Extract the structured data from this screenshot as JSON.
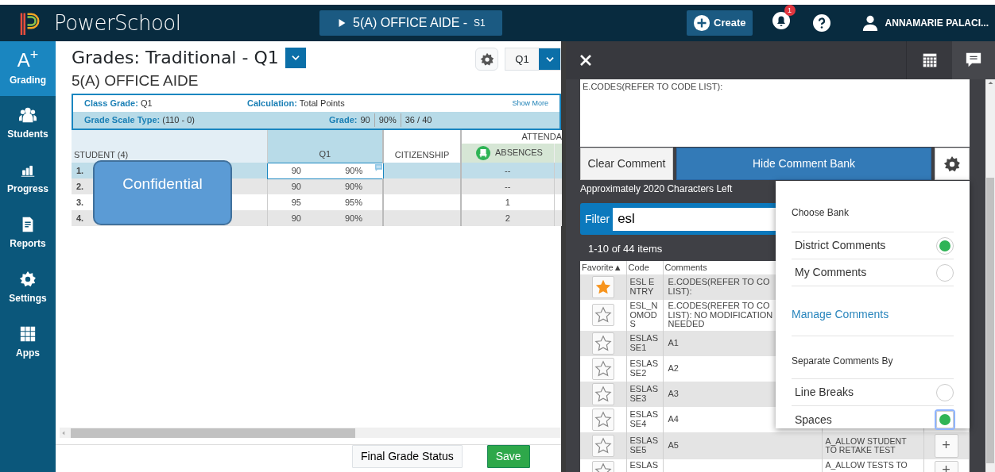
{
  "top_bar": {
    "app_name": "PowerSchool",
    "section": {
      "label": "5(A) OFFICE AIDE -",
      "term": "S1"
    },
    "create": "Create",
    "notification_count": "1",
    "user_name": "ANNAMARIE PALACI..."
  },
  "sidebar": {
    "items": [
      {
        "kind": "grading",
        "icon_text": "A$^{+}$",
        "label": "Grading",
        "selected": true
      },
      {
        "kind": "students",
        "label": "Students",
        "selected": false
      },
      {
        "kind": "progress",
        "label": "Progress",
        "selected": false
      },
      {
        "kind": "reports",
        "label": "Reports",
        "selected": false
      },
      {
        "kind": "settings",
        "label": "Settings",
        "selected": false
      },
      {
        "kind": "apps",
        "label": "Apps",
        "selected": false
      }
    ]
  },
  "main": {
    "title": "Grades: Traditional - Q1",
    "subtitle": "5(A) OFFICE AIDE",
    "term_select": "Q1",
    "summary": {
      "class_grade": "**Class Grade:** Q1",
      "calculation": "**Calculation:** Total Points",
      "show_more": "Show More",
      "grade_scale_type": "**Grade Scale Type:** (110 - 0)",
      "grade_label": "Grade:",
      "grade_parts": [
        "90",
        "90%",
        "36 / 40"
      ]
    },
    "grid": {
      "columns": {
        "student": "STUDENT (4)",
        "q1": "Q1",
        "citizenship": "CITIZENSHIP",
        "group": "ATTENDA",
        "absences": "ABSENCES"
      },
      "rows": [
        {
          "number": "1.",
          "score": "90",
          "percent": "90%",
          "absences": "--",
          "selected": true,
          "has_comment": true
        },
        {
          "number": "2.",
          "score": "90",
          "percent": "90%",
          "absences": "--",
          "selected": false,
          "has_comment": false
        },
        {
          "number": "3.",
          "score": "95",
          "percent": "95%",
          "absences": "1",
          "selected": false,
          "has_comment": false
        },
        {
          "number": "4.",
          "score": "90",
          "percent": "90%",
          "absences": "2",
          "selected": false,
          "has_comment": false
        }
      ]
    },
    "callout": "Confidential",
    "footer_buttons": [
      {
        "kind": "secondary",
        "label": "Final Grade Status"
      },
      {
        "kind": "success",
        "label": "Save"
      }
    ]
  },
  "comment_panel": {
    "comment_text": "E.CODES(REFER TO CODE LIST):",
    "clear_button": "Clear Comment",
    "bank_button": "Hide Comment Bank",
    "chars_left": "Approximately 2020 Characters Left",
    "filter": {
      "label": "Filter",
      "value": "esl"
    },
    "count": "1-10 of 44 items",
    "table": {
      "columns": [
        "Favorite▲",
        "Code",
        "Comments"
      ],
      "rows": [
        {
          "favorite": true,
          "code": "ESL ENTRY",
          "comment": "E.CODES(REFER TO CO\nLIST):"
        },
        {
          "favorite": false,
          "code": "ESL_NOMODS",
          "comment": "E.CODES(REFER TO CO\nLIST): NO MODIFICATION\nNEEDED"
        },
        {
          "favorite": false,
          "code": "ESLASSE1",
          "comment": "A1"
        },
        {
          "favorite": false,
          "code": "ESLASSE2",
          "comment": "A2"
        },
        {
          "favorite": false,
          "code": "ESLASSE3",
          "comment": "A3"
        },
        {
          "favorite": false,
          "code": "ESLASSE4",
          "comment": "A4"
        },
        {
          "favorite": false,
          "code": "ESLASSE5",
          "comment": "A5",
          "column_4": "A_ALLOW STUDENT TO RETAKE TEST",
          "add": "+"
        },
        {
          "favorite": false,
          "code": "ESLAS",
          "column_4": "A_ALLOW TESTS TO",
          "add": "+"
        }
      ]
    },
    "bank_menu": {
      "title": "Choose Bank",
      "banks": [
        {
          "label": "District Comments",
          "selected": true
        },
        {
          "label": "My Comments",
          "selected": false
        }
      ],
      "link": "Manage Comments",
      "separator_title": "Separate Comments By",
      "separators": [
        {
          "label": "Line Breaks",
          "selected": false
        },
        {
          "label": "Spaces",
          "selected": true
        }
      ]
    }
  }
}
